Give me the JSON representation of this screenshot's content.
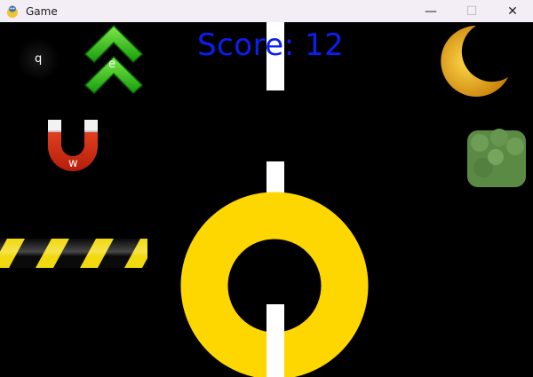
{
  "window": {
    "title": "Game",
    "minimize_glyph": "—",
    "maximize_glyph": "☐",
    "close_glyph": "✕"
  },
  "hud": {
    "score_text": "Score: 12"
  },
  "powerups": {
    "invisibility_key": "q",
    "boost_key": "e",
    "magnet_key": "w"
  },
  "colors": {
    "background": "#000000",
    "lane_line": "#ffffff",
    "player_ring": "#ffd700",
    "score": "#0b1ff0",
    "hazard_yellow": "#f2d90f",
    "boost_green": "#1fa012",
    "magnet_red": "#d52a12",
    "moon_gold": "#e2a712",
    "bush_green": "#5b8a45"
  },
  "icons": [
    "pygame-snake-icon",
    "invisibility-icon",
    "boost-arrows-icon",
    "magnet-icon",
    "moon-icon",
    "bush-icon",
    "hazard-barrier",
    "player-ring"
  ]
}
